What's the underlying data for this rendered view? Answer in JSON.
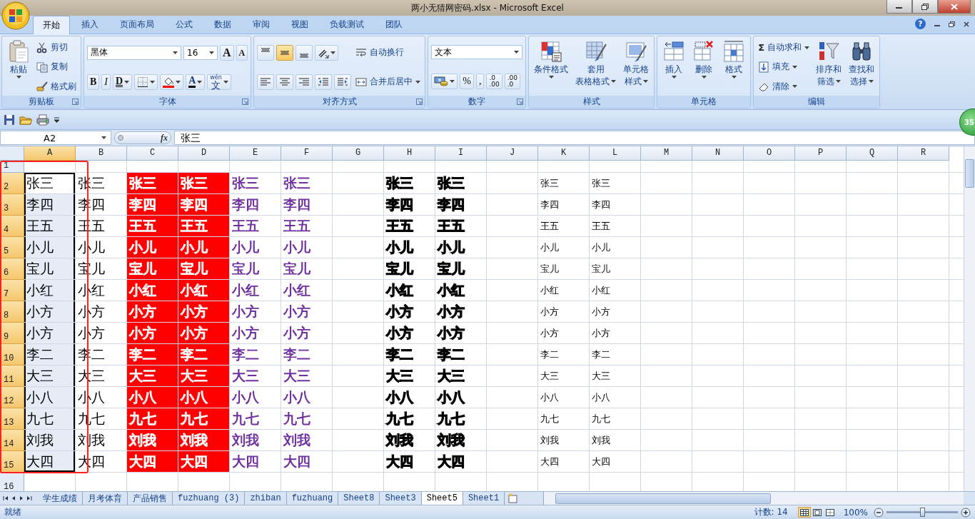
{
  "window": {
    "title": "两小无猜网密码.xlsx - Microsoft Excel",
    "help_button": "?"
  },
  "tabs": [
    {
      "label": "开始",
      "selected": true
    },
    {
      "label": "插入",
      "selected": false
    },
    {
      "label": "页面布局",
      "selected": false
    },
    {
      "label": "公式",
      "selected": false
    },
    {
      "label": "数据",
      "selected": false
    },
    {
      "label": "审阅",
      "selected": false
    },
    {
      "label": "视图",
      "selected": false
    },
    {
      "label": "负载测试",
      "selected": false
    },
    {
      "label": "团队",
      "selected": false
    }
  ],
  "ribbon_groups": [
    {
      "label": "剪贴板",
      "launcher": true,
      "items": [
        {
          "kind": "large",
          "lines": [
            "粘贴"
          ],
          "dropdown": true
        },
        {
          "kind": "stack",
          "lines": [
            [
              {
                "kind": "small",
                "label": "剪切",
                "dropdown": false
              }
            ],
            [
              {
                "kind": "small",
                "label": "复制",
                "dropdown": false
              }
            ],
            [
              {
                "kind": "small",
                "label": "格式刷",
                "dropdown": false
              }
            ]
          ]
        }
      ]
    },
    {
      "label": "字体",
      "launcher": true,
      "items": [
        {
          "kind": "stack",
          "lines": [
            [
              {
                "kind": "name-combo",
                "value": "黑体"
              },
              {
                "kind": "size-combo",
                "value": "16"
              },
              {
                "kind": "glyph",
                "text": "A",
                "dropdown": false
              },
              {
                "kind": "glyph",
                "text": "A",
                "dropdown": false
              }
            ],
            [
              {
                "kind": "glyph",
                "text": "B",
                "dropdown": false
              },
              {
                "kind": "glyph",
                "text": "I",
                "dropdown": false
              },
              {
                "kind": "glyph",
                "text": "D",
                "dropdown": true
              },
              {
                "kind": "icon",
                "dropdown": true
              },
              {
                "kind": "icon",
                "dropdown": true
              },
              {
                "kind": "glyph",
                "text": "A",
                "dropdown": true
              },
              {
                "kind": "glyph",
                "text": "文",
                "ruby": "wén",
                "dropdown": true
              }
            ]
          ]
        }
      ]
    },
    {
      "label": "对齐方式",
      "launcher": true,
      "items": [
        {
          "kind": "stack",
          "lines": [
            [
              {
                "kind": "icon",
                "dropdown": false,
                "selected": false
              },
              {
                "kind": "icon",
                "dropdown": false,
                "selected": true
              },
              {
                "kind": "icon",
                "dropdown": false,
                "selected": false
              },
              {
                "kind": "icon",
                "dropdown": true
              }
            ],
            [
              {
                "kind": "icon",
                "dropdown": false,
                "selected": false
              },
              {
                "kind": "icon",
                "dropdown": false,
                "selected": false
              },
              {
                "kind": "icon",
                "dropdown": false,
                "selected": false
              },
              {
                "kind": "icon",
                "dropdown": false
              },
              {
                "kind": "icon",
                "dropdown": false
              }
            ]
          ]
        },
        {
          "kind": "stack",
          "lines": [
            [
              {
                "kind": "small",
                "label": "自动换行",
                "dropdown": false
              }
            ],
            [
              {
                "kind": "small",
                "label": "合并后居中",
                "dropdown": true
              }
            ]
          ]
        }
      ]
    },
    {
      "label": "数字",
      "launcher": true,
      "items": [
        {
          "kind": "stack",
          "lines": [
            [
              {
                "kind": "format-combo",
                "value": "文本"
              }
            ],
            [
              {
                "kind": "icon",
                "dropdown": true
              },
              {
                "kind": "glyph",
                "text": "%",
                "dropdown": false
              },
              {
                "kind": "glyph",
                "text": ",",
                "dropdown": false
              },
              {
                "kind": "glyph",
                "text": ".00",
                "ruby": ".0",
                "dropdown": false
              },
              {
                "kind": "glyph",
                "text": ".0",
                "ruby": ".00",
                "dropdown": false
              }
            ]
          ]
        }
      ]
    },
    {
      "label": "样式",
      "launcher": false,
      "items": [
        {
          "kind": "large",
          "lines": [
            "条件格式"
          ],
          "dropdown": true
        },
        {
          "kind": "large",
          "lines": [
            "套用",
            "表格格式"
          ],
          "dropdown": true
        },
        {
          "kind": "large",
          "lines": [
            "单元格",
            "样式"
          ],
          "dropdown": true
        }
      ]
    },
    {
      "label": "单元格",
      "launcher": false,
      "items": [
        {
          "kind": "large",
          "lines": [
            "插入"
          ],
          "dropdown": true
        },
        {
          "kind": "large",
          "lines": [
            "删除"
          ],
          "dropdown": true
        },
        {
          "kind": "large",
          "lines": [
            "格式"
          ],
          "dropdown": true
        }
      ]
    },
    {
      "label": "编辑",
      "launcher": false,
      "items": [
        {
          "kind": "stack",
          "lines": [
            [
              {
                "kind": "small",
                "symbol": "Σ",
                "label": "自动求和",
                "dropdown": true
              }
            ],
            [
              {
                "kind": "small",
                "label": "填充",
                "dropdown": true
              }
            ],
            [
              {
                "kind": "small",
                "label": "清除",
                "dropdown": true
              }
            ]
          ]
        },
        {
          "kind": "large",
          "lines": [
            "排序和",
            "筛选"
          ],
          "dropdown": true
        },
        {
          "kind": "large",
          "lines": [
            "查找和",
            "选择"
          ],
          "dropdown": true
        }
      ]
    }
  ],
  "floating_badge": "35",
  "formula_bar": {
    "name_box": "A2",
    "fx": "fx",
    "formula": "张三"
  },
  "columns": [
    {
      "label": "A",
      "selected": true,
      "kind": "plain"
    },
    {
      "label": "B",
      "selected": false,
      "kind": "plain"
    },
    {
      "label": "C",
      "selected": false,
      "kind": "red-fill"
    },
    {
      "label": "D",
      "selected": false,
      "kind": "red-fill"
    },
    {
      "label": "E",
      "selected": false,
      "kind": "purple"
    },
    {
      "label": "F",
      "selected": false,
      "kind": "purple"
    },
    {
      "label": "G",
      "selected": false
    },
    {
      "label": "H",
      "selected": false,
      "kind": "outline"
    },
    {
      "label": "I",
      "selected": false,
      "kind": "outline"
    },
    {
      "label": "J",
      "selected": false
    },
    {
      "label": "K",
      "selected": false,
      "kind": "small"
    },
    {
      "label": "L",
      "selected": false,
      "kind": "small"
    },
    {
      "label": "M",
      "selected": false
    },
    {
      "label": "N",
      "selected": false
    },
    {
      "label": "O",
      "selected": false
    },
    {
      "label": "P",
      "selected": false
    },
    {
      "label": "Q",
      "selected": false
    },
    {
      "label": "R",
      "selected": false
    }
  ],
  "rows": [
    {
      "number": "1",
      "selected": false
    },
    {
      "number": "2",
      "selected": true,
      "cells": [
        "张三",
        "张三",
        "张三",
        "张三",
        "张三",
        "张三",
        "张三",
        "张三",
        "张三",
        "张三"
      ]
    },
    {
      "number": "3",
      "selected": true,
      "cells": [
        "李四",
        "李四",
        "李四",
        "李四",
        "李四",
        "李四",
        "李四",
        "李四",
        "李四",
        "李四"
      ]
    },
    {
      "number": "4",
      "selected": true,
      "cells": [
        "王五",
        "王五",
        "王五",
        "王五",
        "王五",
        "王五",
        "王五",
        "王五",
        "王五",
        "王五"
      ]
    },
    {
      "number": "5",
      "selected": true,
      "cells": [
        "小儿",
        "小儿",
        "小儿",
        "小儿",
        "小儿",
        "小儿",
        "小儿",
        "小儿",
        "小儿",
        "小儿"
      ]
    },
    {
      "number": "6",
      "selected": true,
      "cells": [
        "宝儿",
        "宝儿",
        "宝儿",
        "宝儿",
        "宝儿",
        "宝儿",
        "宝儿",
        "宝儿",
        "宝儿",
        "宝儿"
      ]
    },
    {
      "number": "7",
      "selected": true,
      "cells": [
        "小红",
        "小红",
        "小红",
        "小红",
        "小红",
        "小红",
        "小红",
        "小红",
        "小红",
        "小红"
      ]
    },
    {
      "number": "8",
      "selected": true,
      "cells": [
        "小方",
        "小方",
        "小方",
        "小方",
        "小方",
        "小方",
        "小方",
        "小方",
        "小方",
        "小方"
      ]
    },
    {
      "number": "9",
      "selected": true,
      "cells": [
        "小方",
        "小方",
        "小方",
        "小方",
        "小方",
        "小方",
        "小方",
        "小方",
        "小方",
        "小方"
      ]
    },
    {
      "number": "10",
      "selected": true,
      "cells": [
        "李二",
        "李二",
        "李二",
        "李二",
        "李二",
        "李二",
        "李二",
        "李二",
        "李二",
        "李二"
      ]
    },
    {
      "number": "11",
      "selected": true,
      "cells": [
        "大三",
        "大三",
        "大三",
        "大三",
        "大三",
        "大三",
        "大三",
        "大三",
        "大三",
        "大三"
      ]
    },
    {
      "number": "12",
      "selected": true,
      "cells": [
        "小八",
        "小八",
        "小八",
        "小八",
        "小八",
        "小八",
        "小八",
        "小八",
        "小八",
        "小八"
      ]
    },
    {
      "number": "13",
      "selected": true,
      "cells": [
        "九七",
        "九七",
        "九七",
        "九七",
        "九七",
        "九七",
        "九七",
        "九七",
        "九七",
        "九七"
      ]
    },
    {
      "number": "14",
      "selected": true,
      "cells": [
        "刘我",
        "刘我",
        "刘我",
        "刘我",
        "刘我",
        "刘我",
        "刘我",
        "刘我",
        "刘我",
        "刘我"
      ]
    },
    {
      "number": "15",
      "selected": true,
      "cells": [
        "大四",
        "大四",
        "大四",
        "大四",
        "大四",
        "大四",
        "大四",
        "大四",
        "大四",
        "大四"
      ]
    },
    {
      "number": "16",
      "selected": false
    }
  ],
  "sheet_tabs": [
    {
      "label": "学生成绩",
      "selected": false
    },
    {
      "label": "月考体育",
      "selected": false
    },
    {
      "label": "产品销售",
      "selected": false
    },
    {
      "label": "fuzhuang (3)",
      "selected": false
    },
    {
      "label": "zhiban",
      "selected": false
    },
    {
      "label": "fuzhuang",
      "selected": false
    },
    {
      "label": "Sheet8",
      "selected": false
    },
    {
      "label": "Sheet3",
      "selected": false
    },
    {
      "label": "Sheet5",
      "selected": true
    },
    {
      "label": "Sheet1",
      "selected": false
    }
  ],
  "status_bar": {
    "status": "就绪",
    "count": "计数: 14",
    "views": [
      {
        "selected": true
      },
      {
        "selected": false
      },
      {
        "selected": false
      }
    ],
    "zoom": "100%",
    "zoom_slider": {
      "level": 0.5
    }
  }
}
